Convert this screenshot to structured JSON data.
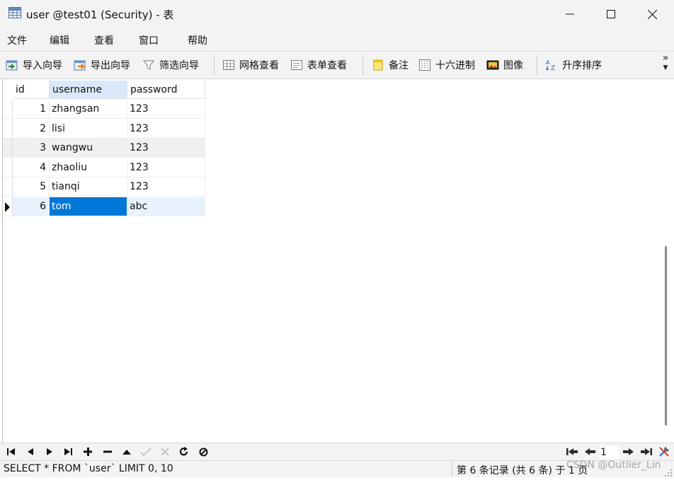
{
  "window": {
    "title": "user @test01 (Security) - 表",
    "icon": "table-icon",
    "controls": [
      "minimize-icon",
      "maximize-icon",
      "close-icon"
    ]
  },
  "menu": {
    "items": [
      "文件",
      "编辑",
      "查看",
      "窗口",
      "帮助"
    ]
  },
  "toolbar": {
    "import": "导入向导",
    "export": "导出向导",
    "filter": "筛选向导",
    "grid_view": "网格查看",
    "form_view": "表单查看",
    "memo": "备注",
    "hex": "十六进制",
    "image": "图像",
    "sort": "升序排序",
    "more": "»"
  },
  "table": {
    "columns": [
      "id",
      "username",
      "password"
    ],
    "rows": [
      {
        "id": "1",
        "username": "zhangsan",
        "password": "123"
      },
      {
        "id": "2",
        "username": "lisi",
        "password": "123"
      },
      {
        "id": "3",
        "username": "wangwu",
        "password": "123"
      },
      {
        "id": "4",
        "username": "zhaoliu",
        "password": "123"
      },
      {
        "id": "5",
        "username": "tianqi",
        "password": "123"
      },
      {
        "id": "6",
        "username": "tom",
        "password": "abc"
      }
    ],
    "current_row": 6,
    "selected_cell": "username"
  },
  "nav": {
    "buttons": [
      "first-record-icon",
      "prev-record-icon",
      "next-record-icon",
      "last-record-icon",
      "add-record-icon",
      "delete-record-icon",
      "apply-icon",
      "confirm-icon",
      "cancel-icon",
      "refresh-icon",
      "stop-icon"
    ],
    "page": "1"
  },
  "status": {
    "sql": "SELECT * FROM `user` LIMIT 0, 10",
    "record_info": "第 6 条记录 (共 6 条) 于 1 页",
    "watermark": "CSDN @Outlier_Lin"
  },
  "colors": {
    "selected_cell": "#0078d7",
    "current_row": "#e8f2fc",
    "alt_row": "#f0f0f0",
    "header_selected": "#d9e9f9"
  }
}
